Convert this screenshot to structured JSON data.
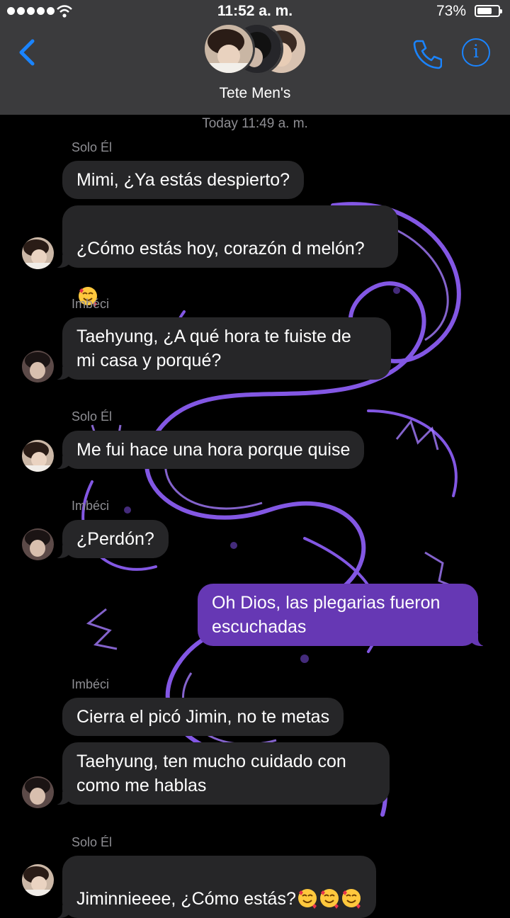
{
  "status_bar": {
    "time": "11:52 a. m.",
    "battery": "73%",
    "battery_level": 0.73
  },
  "header": {
    "title": "Tete Men's",
    "back_icon": "chevron-left-icon",
    "call_icon": "phone-icon",
    "info_icon": "info-icon",
    "info_glyph": "i"
  },
  "accent_color": "#1a84ff",
  "sent_bubble_color": "#6638b4",
  "received_bubble_color": "#262628",
  "thread": {
    "timestamp": "Today 11:49 a. m.",
    "senders": [
      "Solo Él",
      "Imbéci",
      "Solo Él",
      "Imbéci",
      "Imbéci",
      "Solo Él"
    ],
    "messages": [
      "Mimi, ¿Ya estás despierto?",
      "¿Cómo estás hoy, corazón d melón?",
      "Taehyung, ¿A qué hora te fuiste de\nmi casa y porqué?",
      "Me fui hace una hora porque quise",
      "¿Perdón?",
      "Oh Dios, las plegarias fueron\nescuchadas",
      "Cierra el picó Jimin, no te metas",
      "Taehyung, ten mucho cuidado con\ncomo me hablas",
      "Jiminnieeee, ¿Cómo estás?"
    ],
    "emoji_name": "smiling-face-with-hearts-icon"
  }
}
